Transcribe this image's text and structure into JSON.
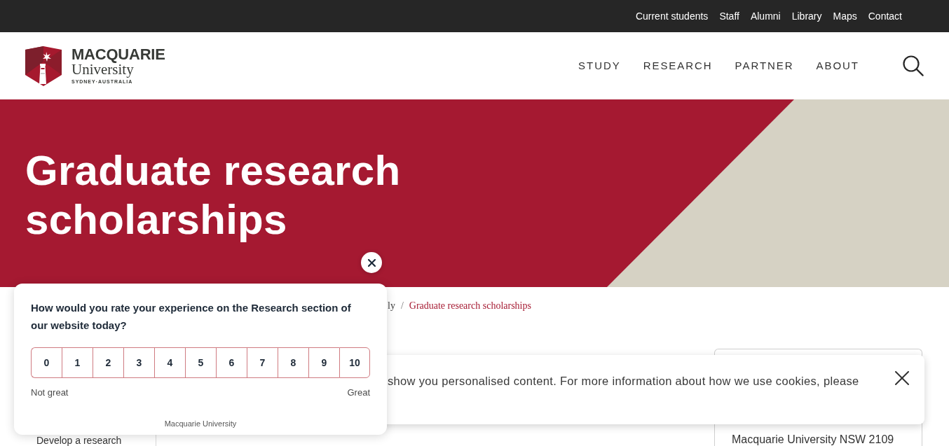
{
  "top_bar": {
    "links": [
      "Current students",
      "Staff",
      "Alumni",
      "Library",
      "Maps",
      "Contact"
    ]
  },
  "header": {
    "logo": {
      "wordmark": "MACQUARIE",
      "subtitle": "University",
      "tagline": "SYDNEY·AUSTRALIA"
    },
    "nav": [
      "STUDY",
      "RESEARCH",
      "PARTNER",
      "ABOUT"
    ]
  },
  "hero": {
    "title": "Graduate research scholarships"
  },
  "breadcrumb": {
    "separator": "/",
    "items": [
      {
        "label": "ly",
        "current": false
      },
      {
        "label": "Graduate research scholarships",
        "current": true
      }
    ]
  },
  "sidebar": {
    "items": [
      "Develop a research"
    ]
  },
  "info_card": {
    "lines": [
      "Macquarie University NSW 2109"
    ]
  },
  "survey_popup": {
    "question": "How would you rate your experience on the Research section of our website today?",
    "options": [
      {
        "label": "0",
        "selected": false
      },
      {
        "label": "1",
        "selected": false
      },
      {
        "label": "2",
        "selected": false
      },
      {
        "label": "3",
        "selected": false
      },
      {
        "label": "4",
        "selected": false
      },
      {
        "label": "5",
        "selected": false
      },
      {
        "label": "6",
        "selected": false
      },
      {
        "label": "7",
        "selected": false
      },
      {
        "label": "8",
        "selected": false
      },
      {
        "label": "9",
        "selected": false
      },
      {
        "label": "10",
        "selected": false
      }
    ],
    "low_label": "Not great",
    "high_label": "Great",
    "footer": "Macquarie University"
  },
  "cookie_banner": {
    "text": "show you personalised content. For more information about how we use cookies, please"
  }
}
